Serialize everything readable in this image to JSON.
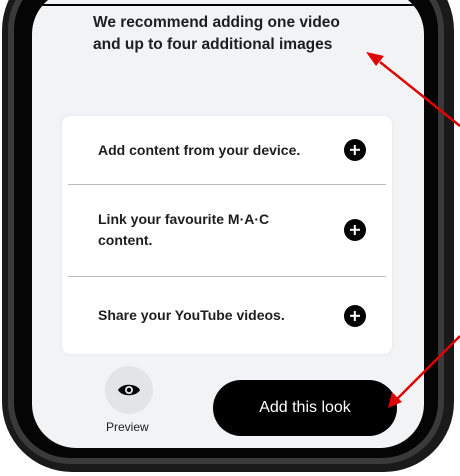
{
  "colors": {
    "screen_bg": "#f2f3f5",
    "card_bg": "#ffffff",
    "primary_button": "#000000",
    "annotation_arrow": "#e00000"
  },
  "info": {
    "recommendation": "We recommend adding one video and up to four additional images"
  },
  "content_options": [
    {
      "label": "Add content from your device.",
      "icon": "plus-circle-icon"
    },
    {
      "label": "Link your favourite M·A·C content.",
      "icon": "plus-circle-icon"
    },
    {
      "label": "Share your YouTube videos.",
      "icon": "plus-circle-icon"
    }
  ],
  "footer": {
    "preview_label": "Preview",
    "preview_icon": "eye-icon",
    "add_look_label": "Add this look"
  }
}
